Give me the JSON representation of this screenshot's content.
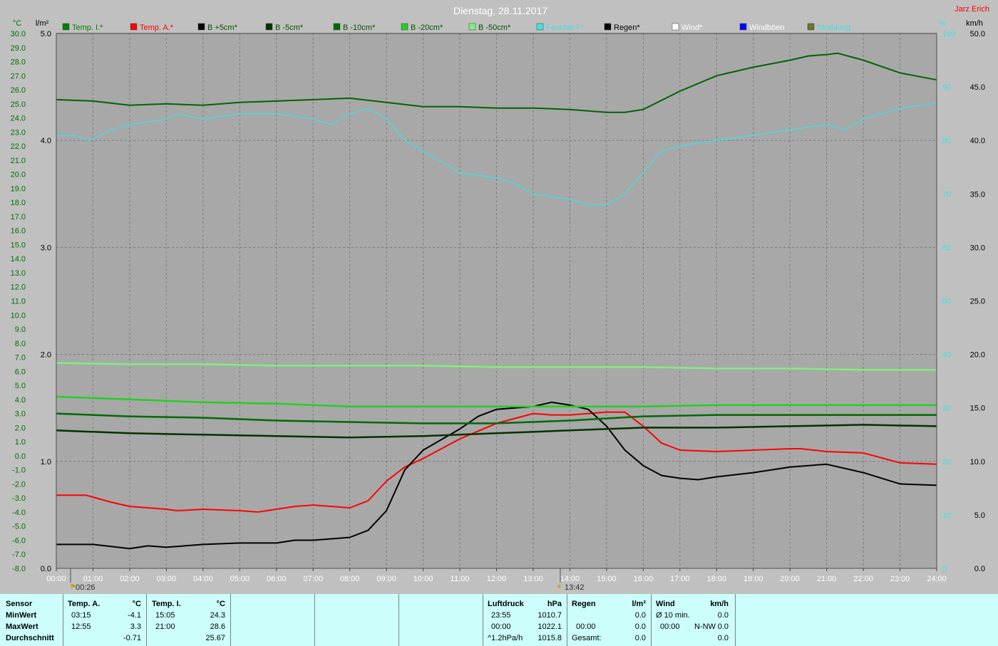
{
  "header": {
    "title": "Dienstag, 28.11.2017",
    "author": "Jarz Erich",
    "left_unit_c": "°C",
    "left_unit_rain": "l/m²",
    "right_unit_pct": "%",
    "right_unit_wind": "km/h"
  },
  "colors": {
    "plot_bg": "#a8a8a8",
    "temp_inside": "#006400",
    "temp_outside": "#ff0000",
    "b5": "#000000",
    "b_minus5": "#003300",
    "b_minus10": "#006a00",
    "b_minus20": "#22d022",
    "b_minus50": "#7cf07c",
    "humidity": "#40e0e0",
    "rain": "#000000",
    "wind": "#ffffff",
    "gust": "#0000ff",
    "radiation": "#707030"
  },
  "legend": [
    {
      "label": "Temp. I.*",
      "color": "#008000",
      "text_color": "#008000"
    },
    {
      "label": "Temp. A.*",
      "color": "#ff0000",
      "text_color": "#ff0000"
    },
    {
      "label": "B +5cm*",
      "color": "#000000",
      "text_color": "#005000"
    },
    {
      "label": "B -5cm*",
      "color": "#003300",
      "text_color": "#005000"
    },
    {
      "label": "B -10cm*",
      "color": "#006a00",
      "text_color": "#005000"
    },
    {
      "label": "B -20cm*",
      "color": "#22d022",
      "text_color": "#005000"
    },
    {
      "label": "B -50cm*",
      "color": "#7cf07c",
      "text_color": "#005000"
    },
    {
      "label": "Feuchte I.*",
      "color": "#40e0e0",
      "text_color": "#40e0e0"
    },
    {
      "label": "Regen*",
      "color": "#000000",
      "text_color": "#000000"
    },
    {
      "label": "Wind*",
      "color": "#ffffff",
      "text_color": "#ffffff"
    },
    {
      "label": "Windböen",
      "color": "#0000ff",
      "text_color": "#ffffff"
    },
    {
      "label": "Strahlung",
      "color": "#707030",
      "text_color": "#40e0e0"
    }
  ],
  "axes": {
    "x_ticks": [
      "00:00",
      "01:00",
      "02:00",
      "03:00",
      "04:00",
      "05:00",
      "06:00",
      "07:00",
      "08:00",
      "09:00",
      "10:00",
      "11:00",
      "12:00",
      "13:00",
      "14:00",
      "15:00",
      "16:00",
      "17:00",
      "18:00",
      "19:00",
      "20:00",
      "21:00",
      "22:00",
      "23:00",
      "24:00"
    ],
    "y_temp_ticks": [
      "30.0",
      "29.0",
      "28.0",
      "27.0",
      "26.0",
      "25.0",
      "24.0",
      "23.0",
      "22.0",
      "21.0",
      "20.0",
      "19.0",
      "18.0",
      "17.0",
      "16.0",
      "15.0",
      "14.0",
      "13.0",
      "12.0",
      "11.0",
      "10.0",
      "9.0",
      "8.0",
      "7.0",
      "6.0",
      "5.0",
      "4.0",
      "3.0",
      "2.0",
      "1.0",
      "0.0",
      "-1.0",
      "-2.0",
      "-3.0",
      "-4.0",
      "-5.0",
      "-6.0",
      "-7.0",
      "-8.0"
    ],
    "y_rain_ticks": [
      "5.0",
      "4.0",
      "3.0",
      "2.0",
      "1.0",
      "0.0"
    ],
    "y_pct_ticks": [
      "100",
      "90",
      "80",
      "70",
      "60",
      "50",
      "40",
      "30",
      "20",
      "10",
      "0"
    ],
    "y_wind_ticks": [
      "50.0",
      "45.0",
      "40.0",
      "35.0",
      "30.0",
      "25.0",
      "20.0",
      "15.0",
      "10.0",
      "5.0",
      "0.0"
    ],
    "marker_min_time": "00:26",
    "marker_max_time": "13:42"
  },
  "chart_data": {
    "type": "line",
    "title": "Dienstag, 28.11.2017",
    "x_unit": "hour",
    "xlim": [
      0,
      24
    ],
    "ylim_temp": [
      -8,
      30
    ],
    "ylim_pct": [
      0,
      100
    ],
    "grid": true,
    "series": [
      {
        "name": "Temp. I.*",
        "axis": "temp",
        "color": "#006400",
        "x": [
          0,
          1,
          2,
          3,
          4,
          5,
          6,
          7,
          8,
          9,
          10,
          11,
          12,
          13,
          14,
          14.5,
          15,
          15.5,
          16,
          17,
          18,
          19,
          20,
          20.5,
          21,
          21.3,
          22,
          23,
          24
        ],
        "y": [
          25.3,
          25.2,
          24.9,
          25.0,
          24.9,
          25.1,
          25.2,
          25.3,
          25.4,
          25.1,
          24.8,
          24.8,
          24.7,
          24.7,
          24.6,
          24.5,
          24.4,
          24.4,
          24.6,
          25.9,
          27.0,
          27.6,
          28.1,
          28.4,
          28.5,
          28.6,
          28.1,
          27.2,
          26.7
        ]
      },
      {
        "name": "Temp. A.*",
        "axis": "temp",
        "color": "#ff0000",
        "x": [
          0,
          0.8,
          1.5,
          2,
          3,
          3.3,
          4,
          5,
          5.5,
          6,
          6.5,
          7,
          7.5,
          8,
          8.5,
          9,
          9.5,
          10,
          11,
          12,
          13,
          13.5,
          14,
          15,
          15.5,
          16,
          16.5,
          17,
          18,
          19,
          20,
          20.3,
          21,
          22,
          23,
          24
        ],
        "y": [
          -2.8,
          -2.8,
          -3.3,
          -3.6,
          -3.8,
          -3.9,
          -3.8,
          -3.9,
          -4.0,
          -3.8,
          -3.6,
          -3.5,
          -3.6,
          -3.7,
          -3.2,
          -1.8,
          -0.8,
          -0.2,
          1.2,
          2.3,
          3.0,
          2.9,
          2.9,
          3.1,
          3.1,
          2.1,
          0.9,
          0.4,
          0.3,
          0.4,
          0.5,
          0.5,
          0.3,
          0.2,
          -0.5,
          -0.6
        ]
      },
      {
        "name": "B +5cm*",
        "axis": "temp",
        "color": "#000000",
        "x": [
          0,
          1,
          2,
          2.5,
          3,
          4,
          5,
          6,
          6.5,
          7,
          8,
          8.5,
          9,
          9.5,
          10,
          11,
          11.5,
          12,
          12.5,
          13,
          13.5,
          14,
          14.5,
          15,
          15.5,
          16,
          16.5,
          17,
          17.5,
          18,
          19,
          20,
          21,
          22,
          23,
          24
        ],
        "y": [
          -6.3,
          -6.3,
          -6.6,
          -6.4,
          -6.5,
          -6.3,
          -6.2,
          -6.2,
          -6.0,
          -6.0,
          -5.8,
          -5.3,
          -3.9,
          -1.0,
          0.4,
          1.9,
          2.8,
          3.3,
          3.4,
          3.5,
          3.8,
          3.6,
          3.3,
          2.1,
          0.4,
          -0.7,
          -1.4,
          -1.6,
          -1.7,
          -1.5,
          -1.2,
          -0.8,
          -0.6,
          -1.2,
          -2.0,
          -2.1
        ]
      },
      {
        "name": "B -5cm*",
        "axis": "temp",
        "color": "#003300",
        "x": [
          0,
          2,
          4,
          6,
          8,
          10,
          12,
          14,
          16,
          18,
          20,
          22,
          24
        ],
        "y": [
          1.8,
          1.6,
          1.5,
          1.4,
          1.3,
          1.4,
          1.6,
          1.8,
          2.0,
          2.0,
          2.1,
          2.2,
          2.1
        ]
      },
      {
        "name": "B -10cm*",
        "axis": "temp",
        "color": "#006a00",
        "x": [
          0,
          2,
          4,
          6,
          8,
          10,
          12,
          14,
          16,
          18,
          20,
          22,
          24
        ],
        "y": [
          3.0,
          2.8,
          2.7,
          2.5,
          2.4,
          2.3,
          2.3,
          2.5,
          2.8,
          2.9,
          2.9,
          2.9,
          2.9
        ]
      },
      {
        "name": "B -20cm*",
        "axis": "temp",
        "color": "#22d022",
        "x": [
          0,
          2,
          4,
          6,
          8,
          10,
          12,
          14,
          16,
          18,
          20,
          22,
          24
        ],
        "y": [
          4.2,
          4.0,
          3.8,
          3.7,
          3.5,
          3.5,
          3.5,
          3.5,
          3.5,
          3.6,
          3.6,
          3.6,
          3.6
        ]
      },
      {
        "name": "B -50cm*",
        "axis": "temp",
        "color": "#7cf07c",
        "x": [
          0,
          2,
          4,
          6,
          8,
          10,
          12,
          14,
          16,
          18,
          20,
          22,
          24
        ],
        "y": [
          6.6,
          6.5,
          6.5,
          6.4,
          6.4,
          6.4,
          6.3,
          6.3,
          6.3,
          6.2,
          6.2,
          6.1,
          6.1
        ]
      },
      {
        "name": "Feuchte I.*",
        "axis": "pct",
        "color": "#40e0e0",
        "x": [
          0,
          0.5,
          0.9,
          1.5,
          2,
          3,
          3.3,
          4,
          5,
          6,
          7,
          7.5,
          8,
          8.5,
          9,
          9.5,
          10,
          11,
          12,
          12.5,
          13,
          14,
          14.5,
          15,
          15.5,
          16,
          16.5,
          17,
          18,
          19,
          20,
          21,
          21.5,
          22,
          23,
          24
        ],
        "y": [
          81,
          81,
          80,
          82,
          83,
          84,
          85,
          84,
          85,
          85,
          84,
          83,
          85,
          86,
          84,
          80,
          78,
          74,
          73,
          72,
          70,
          69,
          68,
          68,
          70,
          74,
          78,
          79,
          80,
          81,
          82,
          83,
          82,
          84,
          86,
          87
        ]
      },
      {
        "name": "Strahlung",
        "axis": "pct",
        "color": "#707030",
        "x": [
          0,
          24
        ],
        "y": [
          100,
          100
        ]
      }
    ]
  },
  "stats": {
    "sensor_label": "Sensor",
    "min_label": "MinWert",
    "max_label": "MaxWert",
    "avg_label": "Durchschnitt",
    "temp_a": {
      "header": "Temp. A.",
      "unit": "°C",
      "min_time": "03:15",
      "min": "-4.1",
      "max_time": "12:55",
      "max": "3.3",
      "avg": "-0.71"
    },
    "temp_i": {
      "header": "Temp. I.",
      "unit": "°C",
      "min_time": "15:05",
      "min": "24.3",
      "max_time": "21:00",
      "max": "28.6",
      "avg": "25.67"
    },
    "pressure": {
      "header": "Luftdruck",
      "unit": "hPa",
      "min_time": "23:55",
      "min": "1010.7",
      "max_time": "00:00",
      "max": "1022.1",
      "trend": "^1.2hPa/h",
      "avg": "1015.8"
    },
    "rain": {
      "header": "Regen",
      "unit": "l/m²",
      "row1": "0.0",
      "row2_time": "00:00",
      "row2": "0.0",
      "total_label": "Gesamt:",
      "total": "0.0"
    },
    "wind": {
      "header": "Wind",
      "unit": "km/h",
      "avg10_label": "Ø 10 min.",
      "avg10": "0.0",
      "max_time": "00:00",
      "max_dir": "N-NW",
      "max": "0.0",
      "row3": "0.0"
    }
  }
}
